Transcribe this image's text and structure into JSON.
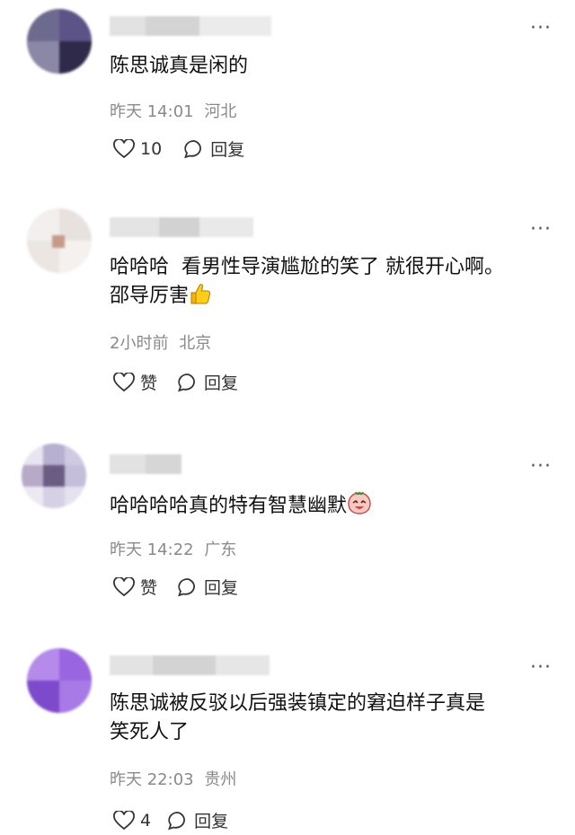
{
  "comments": [
    {
      "text_lines": [
        "陈思诚真是闲的"
      ],
      "time": "昨天 14:01",
      "location": "河北",
      "like_label": "10",
      "reply_label": "回复",
      "more_icon": "more-icon"
    },
    {
      "text_lines": [
        "哈哈哈  看男性导演尴尬的笑了 就很开心啊。",
        "邵导厉害"
      ],
      "emoji": "thumbs-up-emoji",
      "time": "2小时前",
      "location": "北京",
      "like_label": "赞",
      "reply_label": "回复",
      "more_icon": "more-icon"
    },
    {
      "text_lines": [
        "哈哈哈哈真的特有智慧幽默"
      ],
      "emoji": "laughing-face-emoji",
      "time": "昨天 14:22",
      "location": "广东",
      "like_label": "赞",
      "reply_label": "回复",
      "more_icon": "more-icon"
    },
    {
      "text_lines": [
        "陈思诚被反驳以后强装镇定的窘迫样子真是",
        "笑死人了"
      ],
      "time": "昨天 22:03",
      "location": "贵州",
      "like_label": "4",
      "reply_label": "回复",
      "more_icon": "more-icon"
    }
  ]
}
